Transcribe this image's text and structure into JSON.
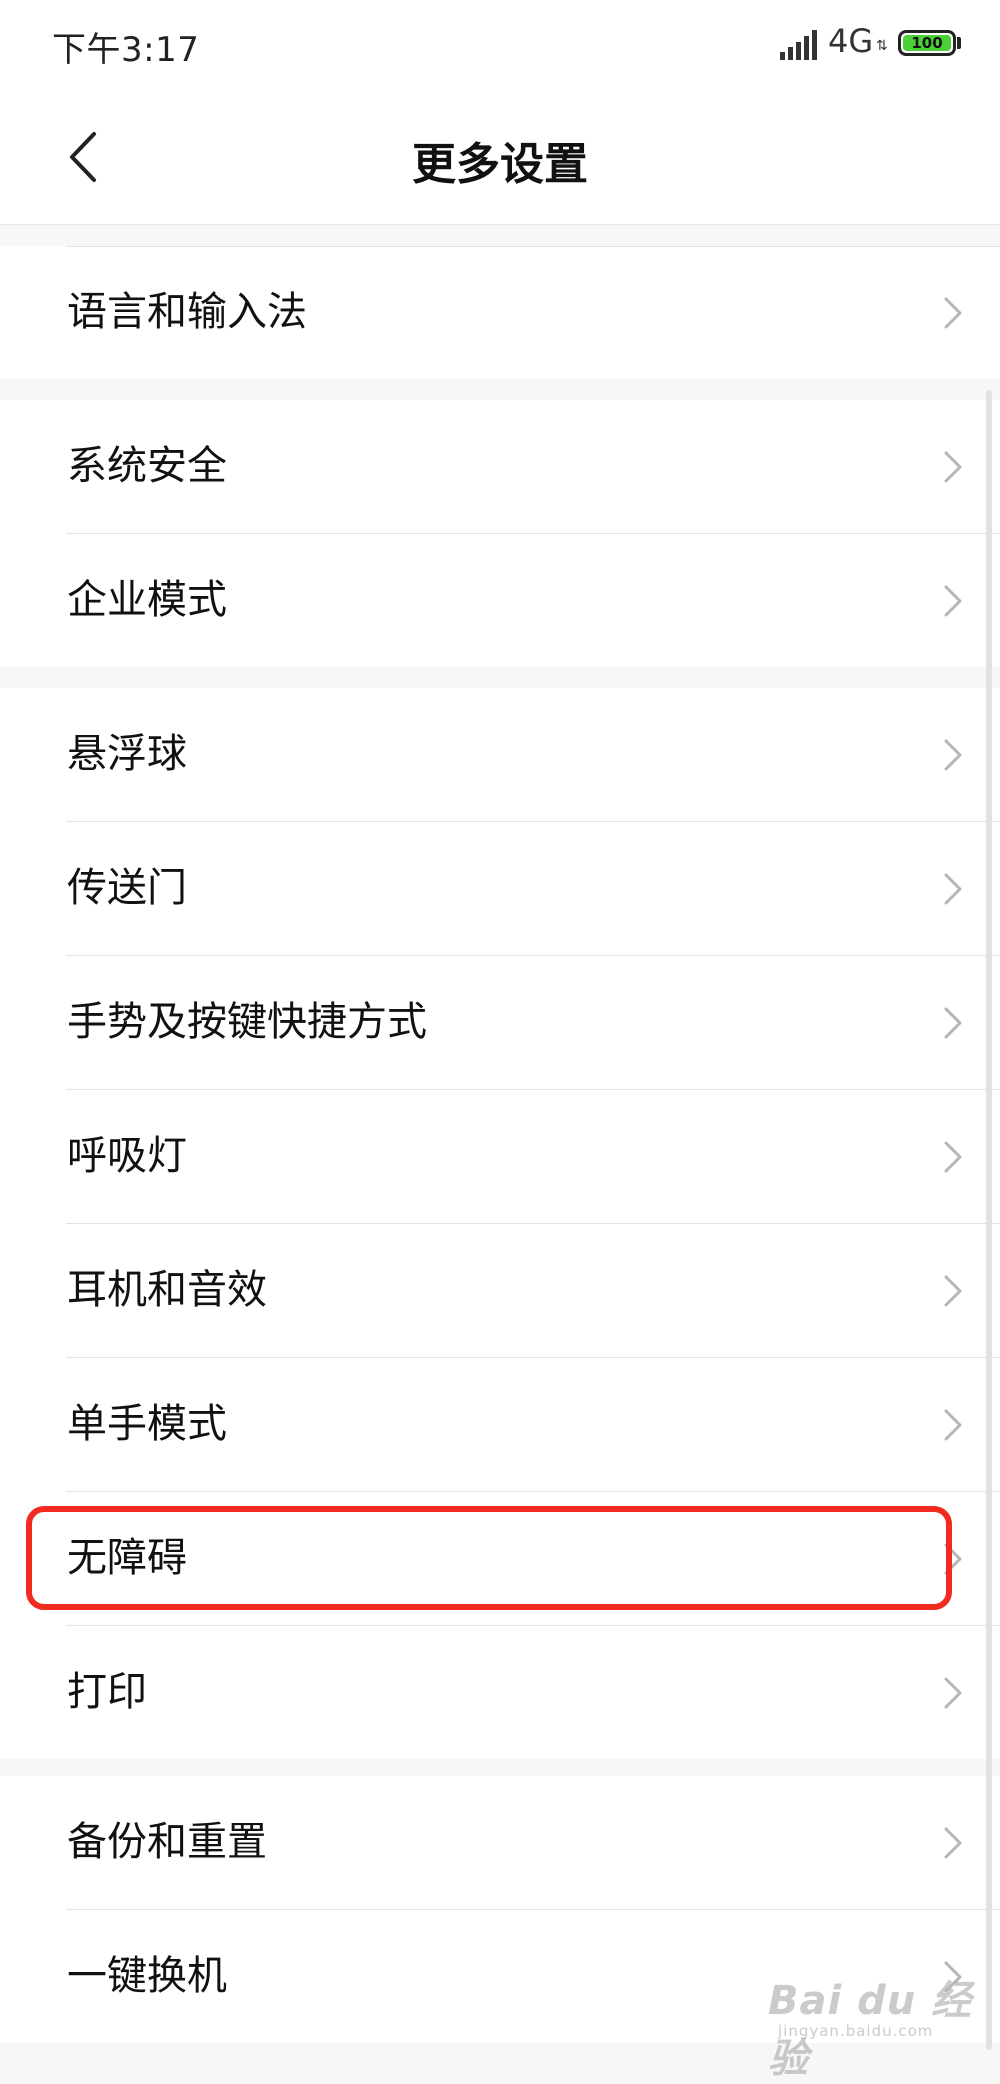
{
  "status_bar": {
    "time": "下午3:17",
    "network": "4G",
    "battery": "100",
    "signal_icon": "signal-icon",
    "battery_color": "#4cd038"
  },
  "header": {
    "title": "更多设置",
    "back_icon": "chevron-left-icon"
  },
  "groups": [
    {
      "items": [
        {
          "label": "语言和输入法"
        }
      ]
    },
    {
      "items": [
        {
          "label": "系统安全"
        },
        {
          "label": "企业模式"
        }
      ]
    },
    {
      "items": [
        {
          "label": "悬浮球"
        },
        {
          "label": "传送门"
        },
        {
          "label": "手势及按键快捷方式"
        },
        {
          "label": "呼吸灯"
        },
        {
          "label": "耳机和音效"
        },
        {
          "label": "单手模式"
        },
        {
          "label": "无障碍",
          "highlighted": true
        },
        {
          "label": "打印"
        }
      ]
    },
    {
      "items": [
        {
          "label": "备份和重置"
        },
        {
          "label": "一键换机"
        }
      ]
    }
  ],
  "highlight_color": "#f22b20",
  "watermark": {
    "brand": "Bai du 经验",
    "sub": "jingyan.baidu.com"
  }
}
